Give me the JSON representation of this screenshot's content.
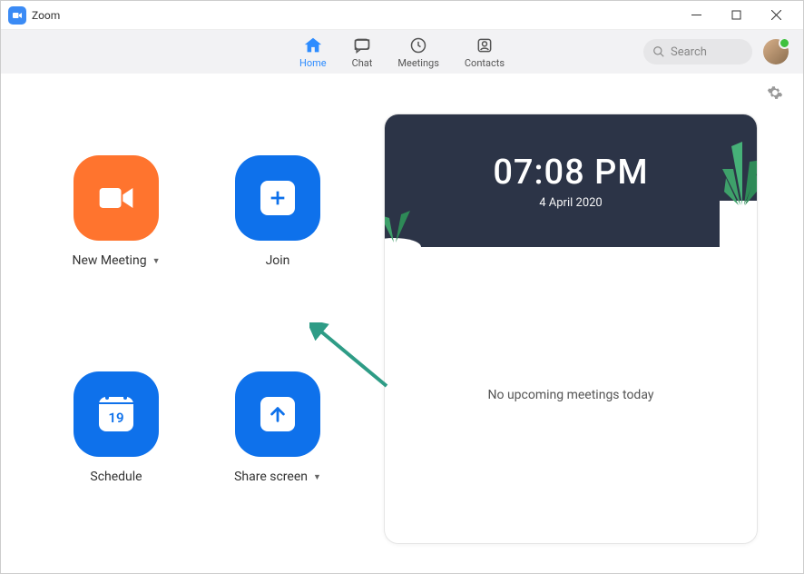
{
  "window": {
    "title": "Zoom"
  },
  "tabs": {
    "home": "Home",
    "chat": "Chat",
    "meetings": "Meetings",
    "contacts": "Contacts"
  },
  "search": {
    "placeholder": "Search"
  },
  "actions": {
    "new_meeting": "New Meeting",
    "join": "Join",
    "schedule": "Schedule",
    "schedule_day": "19",
    "share_screen": "Share screen"
  },
  "panel": {
    "time": "07:08 PM",
    "date": "4 April 2020",
    "status": "No upcoming meetings today"
  },
  "colors": {
    "accent": "#2d8cff",
    "orange": "#ff742e",
    "blue": "#0e71eb",
    "hero": "#2c3447"
  }
}
